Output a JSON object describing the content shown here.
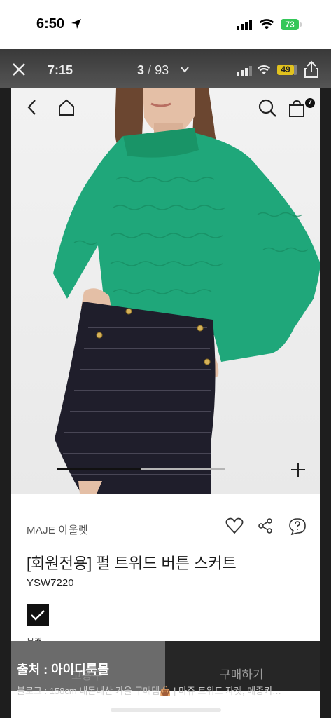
{
  "outer_status": {
    "time": "6:50",
    "battery": "73"
  },
  "viewer": {
    "time": "7:15",
    "current": "3",
    "separator": "/",
    "total": "93",
    "battery": "49"
  },
  "product_nav": {
    "cart_count": "7"
  },
  "gallery": {
    "progress": 0.5
  },
  "product": {
    "brand": "MAJE 아울렛",
    "title": "[회원전용] 펄 트위드 버튼 스커트",
    "code": "YSW7220",
    "color_name": "블랙"
  },
  "purchase": {
    "left_label": "고용구",
    "buy_label": "구매하기"
  },
  "overlay": {
    "source": "출처 : 아이디룩몰",
    "blog": "블로그 : 158cm 내돈내산 가을 구매템👜 | 마쥬 트위드 자켓, 메종키…"
  },
  "colors": {
    "sweater": "#1fa77a",
    "skirt": "#1f1e2b",
    "badge_green": "#34c759",
    "badge_yellow": "#f2d01e"
  }
}
